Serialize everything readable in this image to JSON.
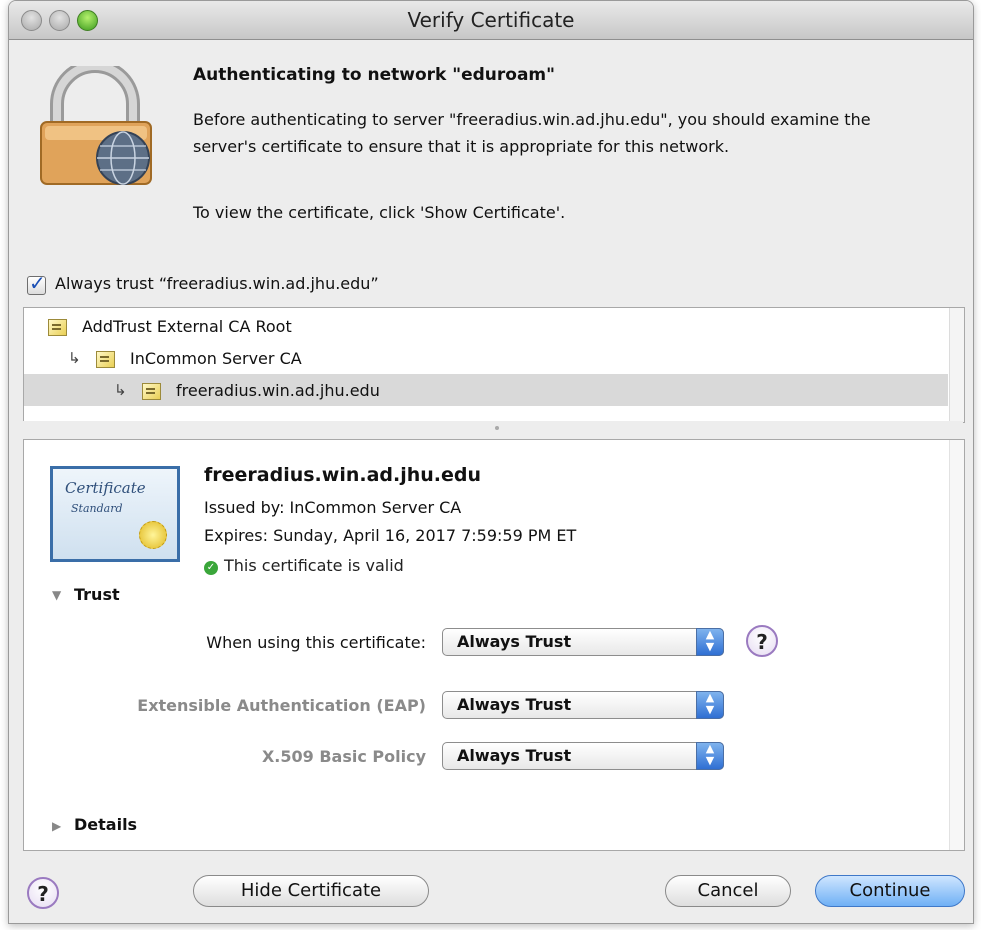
{
  "window": {
    "title": "Verify Certificate"
  },
  "dialog": {
    "heading": "Authenticating to network \"eduroam\"",
    "message": "Before authenticating to server \"freeradius.win.ad.jhu.edu\", you should examine the server's certificate to ensure that it is appropriate for this network.",
    "instruction": "To view the certificate, click 'Show Certificate'.",
    "always_trust_label": "Always trust “freeradius.win.ad.jhu.edu”",
    "always_trust_checked": true
  },
  "cert_chain": [
    {
      "label": "AddTrust External CA Root",
      "level": 0,
      "selected": false
    },
    {
      "label": "InCommon Server CA",
      "level": 1,
      "selected": false
    },
    {
      "label": "freeradius.win.ad.jhu.edu",
      "level": 2,
      "selected": true
    }
  ],
  "certificate": {
    "name": "freeradius.win.ad.jhu.edu",
    "issued_by": "Issued by: InCommon Server CA",
    "expires": "Expires: Sunday, April 16, 2017 7:59:59 PM ET",
    "status": "This certificate is valid",
    "badge_line1": "Certificate",
    "badge_line2": "Standard"
  },
  "trust": {
    "section_label": "Trust",
    "rows": [
      {
        "label": "When using this certificate:",
        "value": "Always Trust"
      },
      {
        "label": "Extensible Authentication (EAP)",
        "value": "Always Trust"
      },
      {
        "label": "X.509 Basic Policy",
        "value": "Always Trust"
      }
    ],
    "help_label": "?"
  },
  "details": {
    "section_label": "Details"
  },
  "buttons": {
    "help": "?",
    "hide_certificate": "Hide Certificate",
    "cancel": "Cancel",
    "continue": "Continue"
  }
}
